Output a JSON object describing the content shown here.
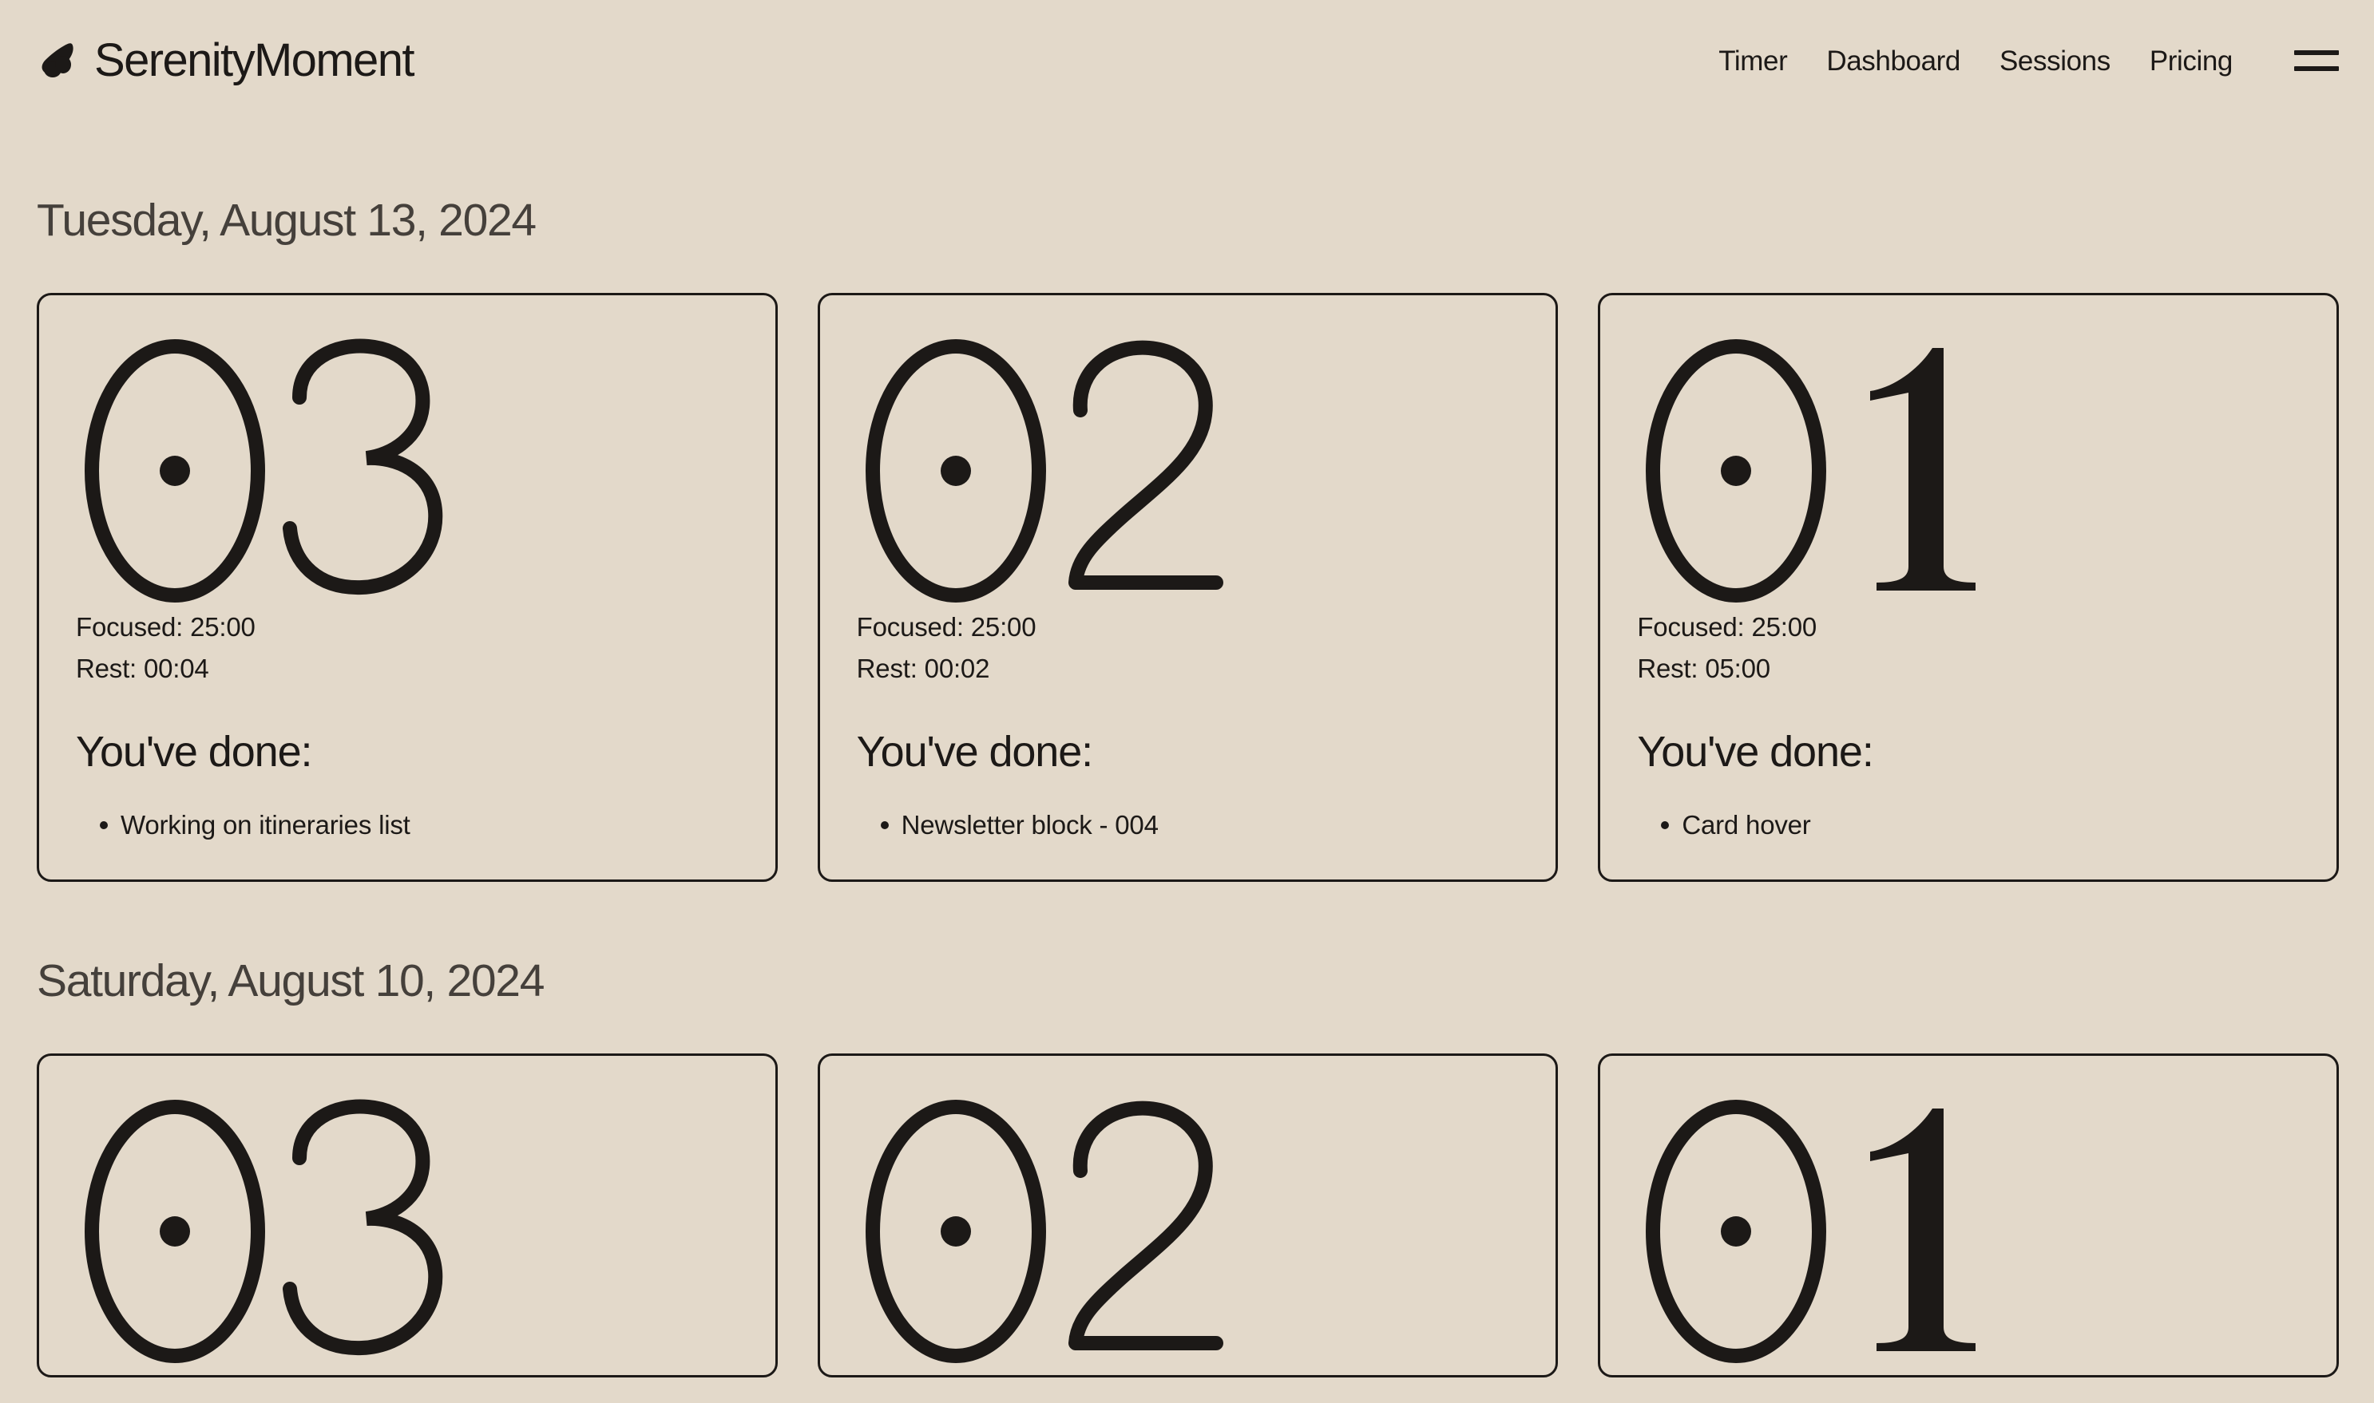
{
  "brand": {
    "name": "SerenityMoment",
    "icon": "leaf-blob-icon"
  },
  "nav": {
    "items": [
      {
        "label": "Timer"
      },
      {
        "label": "Dashboard"
      },
      {
        "label": "Sessions"
      },
      {
        "label": "Pricing"
      }
    ],
    "menu_icon": "hamburger-menu-icon"
  },
  "theme": {
    "background": "#e3d9ca",
    "ink": "#1c1917",
    "heading": "#45403b"
  },
  "day_groups": [
    {
      "date": "Tuesday, August 13, 2024",
      "sessions": [
        {
          "number": "03",
          "focused_label": "Focused: 25:00",
          "rest_label": "Rest: 00:04",
          "done_title": "You've done:",
          "done_items": [
            "Working on itineraries list"
          ]
        },
        {
          "number": "02",
          "focused_label": "Focused: 25:00",
          "rest_label": "Rest: 00:02",
          "done_title": "You've done:",
          "done_items": [
            "Newsletter block - 004"
          ]
        },
        {
          "number": "01",
          "focused_label": "Focused: 25:00",
          "rest_label": "Rest: 05:00",
          "done_title": "You've done:",
          "done_items": [
            "Card hover"
          ]
        }
      ]
    },
    {
      "date": "Saturday, August 10, 2024",
      "sessions": [
        {
          "number": "03"
        },
        {
          "number": "02"
        },
        {
          "number": "01"
        }
      ]
    }
  ]
}
